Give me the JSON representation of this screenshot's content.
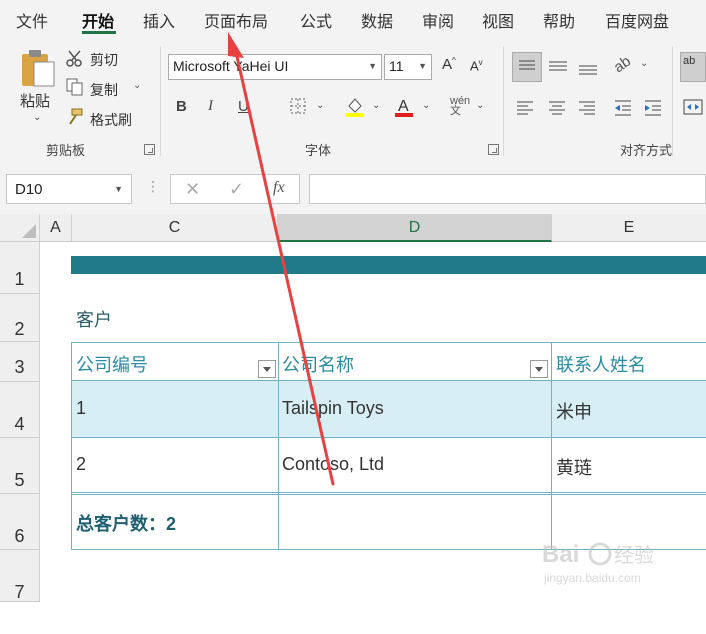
{
  "ribbon": {
    "tabs": [
      "文件",
      "开始",
      "插入",
      "页面布局",
      "公式",
      "数据",
      "审阅",
      "视图",
      "帮助",
      "百度网盘"
    ],
    "active_tab": "开始",
    "clipboard": {
      "paste_label": "粘贴",
      "cut_label": "剪切",
      "copy_label": "复制",
      "format_painter_label": "格式刷",
      "group_label": "剪贴板"
    },
    "font": {
      "font_name": "Microsoft YaHei UI",
      "font_size": "11",
      "group_label": "字体"
    },
    "alignment": {
      "group_label": "对齐方式"
    }
  },
  "formula_bar": {
    "name_box": "D10",
    "fx_label": "fx",
    "formula": ""
  },
  "grid": {
    "columns": [
      "A",
      "C",
      "D",
      "E"
    ],
    "selected_column": "D",
    "rows": [
      "1",
      "2",
      "3",
      "4",
      "5",
      "6",
      "7"
    ]
  },
  "sheet": {
    "section_title": "客户",
    "table": {
      "headers": [
        "公司编号",
        "公司名称",
        "联系人姓名"
      ],
      "rows": [
        [
          "1",
          "Tailspin Toys",
          "米申"
        ],
        [
          "2",
          "Contoso, Ltd",
          "黄琏"
        ]
      ],
      "total_label": "总客户数：2"
    }
  },
  "colors": {
    "excel_green": "#217346",
    "table_band": "#217a8a",
    "row_highlight": "#d6eef4",
    "table_header_text": "#2a8ca3",
    "annotation_arrow": "#e84141"
  },
  "watermark": {
    "logo": "Baidu经验",
    "url": "jingyan.baidu.com"
  }
}
